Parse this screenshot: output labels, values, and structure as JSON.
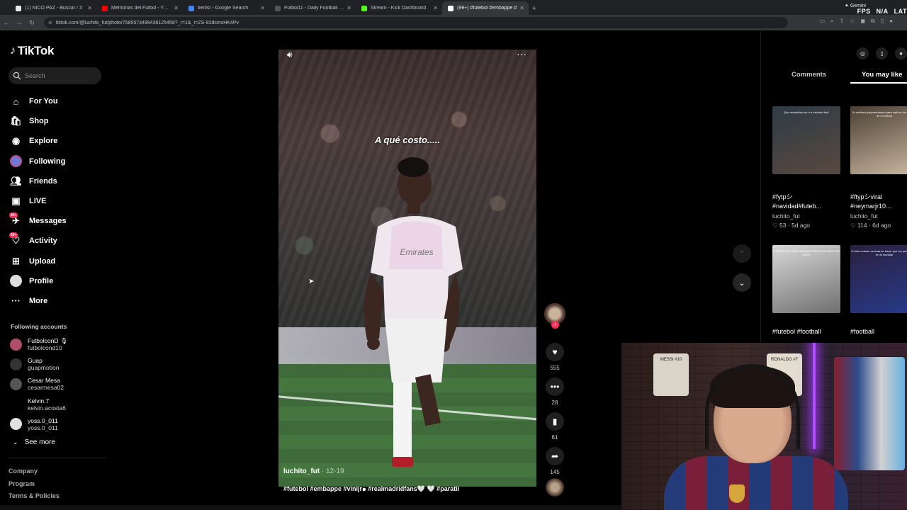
{
  "browser": {
    "tabs": [
      {
        "title": "(1) NICO PAZ - Buscar / X",
        "color": "#e8eaed",
        "active": false
      },
      {
        "title": "Memorias del Fútbol - YouTube",
        "color": "#ff0000",
        "active": false
      },
      {
        "title": "tierlist - Google Search",
        "color": "#4285f4",
        "active": false
      },
      {
        "title": "Futbol11 - Daily Football Games",
        "color": "#555555",
        "active": false
      },
      {
        "title": "Stream - Kick Dashboard",
        "color": "#53fc18",
        "active": false
      },
      {
        "title": "(99+) #futebol #embappe #",
        "color": "#ffffff",
        "active": true
      }
    ],
    "url": "tiktok.com/@luchito_fut/photo/758557349943612545​8?_r=1&_t=ZS-92dsmsHK4Pv",
    "gemini_label": "Gemini",
    "overlay": [
      "FPS",
      "N/A",
      "LAT"
    ]
  },
  "sidebar": {
    "logo": "TikTok",
    "search_placeholder": "Search",
    "nav": [
      {
        "label": "For You",
        "icon": "home"
      },
      {
        "label": "Shop",
        "icon": "shop"
      },
      {
        "label": "Explore",
        "icon": "compass"
      },
      {
        "label": "Following",
        "icon": "avatar"
      },
      {
        "label": "Friends",
        "icon": "friends"
      },
      {
        "label": "LIVE",
        "icon": "live"
      },
      {
        "label": "Messages",
        "icon": "messages",
        "badge": "99+"
      },
      {
        "label": "Activity",
        "icon": "activity",
        "badge": "99+"
      },
      {
        "label": "Upload",
        "icon": "upload"
      },
      {
        "label": "Profile",
        "icon": "profile"
      },
      {
        "label": "More",
        "icon": "more"
      }
    ],
    "following_title": "Following accounts",
    "accounts": [
      {
        "name": "FutbolconD 🎙",
        "handle": "futbolcond10",
        "color": "#b04c6c"
      },
      {
        "name": "Guap",
        "handle": "guapmotion",
        "color": "#333333"
      },
      {
        "name": "Cesar Mesa",
        "handle": "cesarmesa02",
        "color": "#555555"
      },
      {
        "name": "Kelvin.7",
        "handle": "kelvin.acosta6",
        "color": "#000000"
      },
      {
        "name": "yoss.0_011",
        "handle": "yoss.0_011",
        "color": "#e0e0e0"
      }
    ],
    "see_more": "See more",
    "footer": [
      "Company",
      "Program",
      "Terms & Policies"
    ]
  },
  "video": {
    "caption": "A qué costo.....",
    "author": "luchito_fut",
    "date": "12-19",
    "tags": "#futebol #embappe #viniјr๑ #realmadridfans🤍 🤍 #paratii",
    "likes": "555",
    "comments": "28",
    "saves": "61",
    "shares": "145"
  },
  "right_panel": {
    "tabs": [
      "Comments",
      "You may like"
    ],
    "cards": [
      {
        "title": "#fytpシ #navidad#futeb...",
        "user": "luchito_fut",
        "likes": "53",
        "age": "5d ago",
        "thumb_text": "Que necesidad por ir a navidad iba?",
        "colors": [
          "#2e3b46",
          "#59493f"
        ]
      },
      {
        "title": "#ftypシviral #neymarjr10...",
        "user": "luchito_fut",
        "likes": "114",
        "age": "6d ago",
        "thumb_text": "Yo mañana preparándome para salir en los retratos de mi mamá",
        "colors": [
          "#4b4034",
          "#c9b7a0"
        ]
      },
      {
        "title": "#futebol #football",
        "user": "",
        "likes": "",
        "age": "",
        "thumb_text": "50 AÑOS POR PRA TREINAR AGORA EU NEM VOU MAIS",
        "colors": [
          "#d8d8d8",
          "#6f6f6f"
        ]
      },
      {
        "title": "#football",
        "user": "",
        "likes": "",
        "age": "",
        "thumb_text": "Vi todo cuando se trata de hacer que los que jugaron en el mundial",
        "colors": [
          "#2a2140",
          "#283a8a"
        ]
      }
    ]
  },
  "webcam": {
    "frame_labels": [
      "MESSI #10",
      "RONALDO #7"
    ]
  }
}
